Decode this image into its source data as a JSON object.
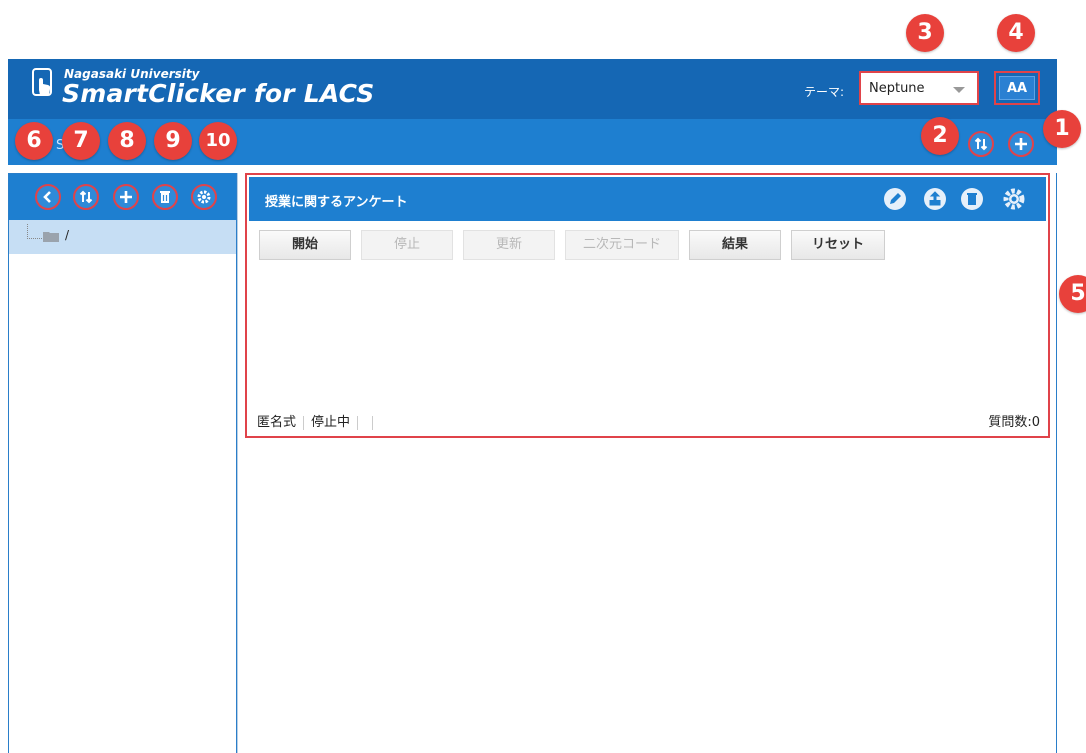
{
  "header": {
    "logo_sub": "Nagasaki University",
    "logo_main": "SmartClicker for LACS",
    "theme_label": "テーマ:",
    "theme_value": "Neptune",
    "font_size_button": "AA"
  },
  "toolbar": {
    "partial_text": "S        会"
  },
  "tree": {
    "root_label": "/"
  },
  "panel": {
    "title": "授業に関するアンケート",
    "buttons": [
      {
        "label": "開始",
        "enabled": true
      },
      {
        "label": "停止",
        "enabled": false
      },
      {
        "label": "更新",
        "enabled": false
      },
      {
        "label": "二次元コード",
        "enabled": false
      },
      {
        "label": "結果",
        "enabled": true
      },
      {
        "label": "リセット",
        "enabled": true
      }
    ],
    "status_mode": "匿名式",
    "status_state": "停止中",
    "question_count": "質問数:0"
  },
  "badges": [
    "1",
    "2",
    "3",
    "4",
    "5",
    "6",
    "7",
    "8",
    "9",
    "10"
  ],
  "colors": {
    "header_bg": "#1567b4",
    "toolbar_bg": "#1e7fd0",
    "callout_red": "#e8413b",
    "selected_row": "#c6def4"
  }
}
